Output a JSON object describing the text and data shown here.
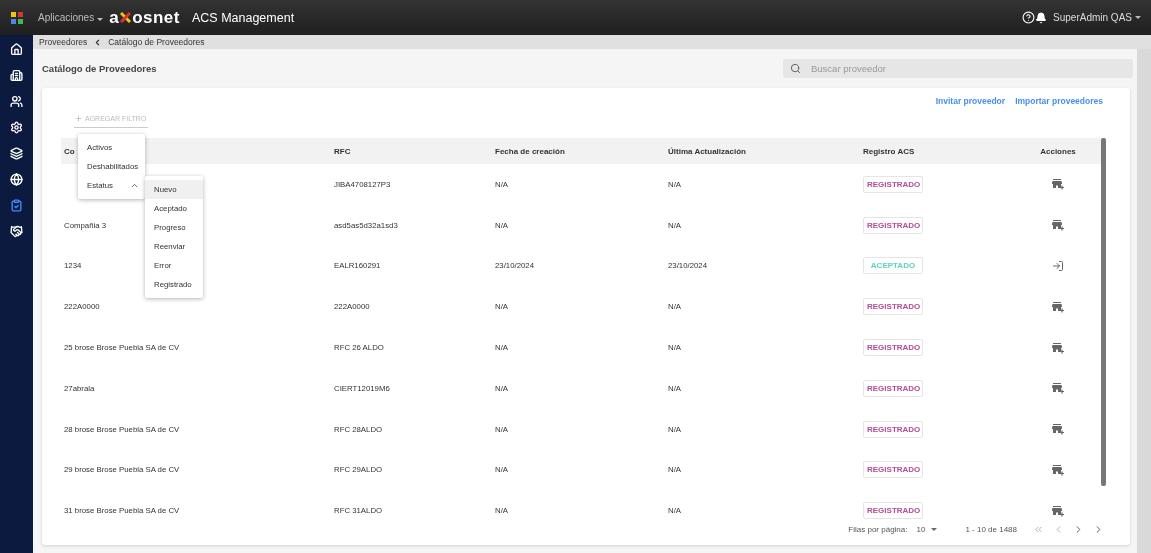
{
  "topbar": {
    "apps_label": "Aplicaciones",
    "logo": {
      "before": "a",
      "after": "osnet"
    },
    "title": "ACS Management",
    "user": "SuperAdmin QAS"
  },
  "sidebar": {
    "items": [
      {
        "selected": false
      },
      {
        "selected": false
      },
      {
        "selected": false
      },
      {
        "selected": false
      },
      {
        "selected": false
      },
      {
        "selected": false
      },
      {
        "selected": true
      },
      {
        "selected": false
      }
    ]
  },
  "breadcrumb": {
    "parent": "Proveedores",
    "current": "Catálogo de Proveedores"
  },
  "page_title": "Catálogo de Proveedores",
  "search": {
    "placeholder": "Buscar proveedor"
  },
  "links": [
    "Invitar proveedor",
    "Importar proveedores"
  ],
  "add_filter": "AGREGAR FILTRO",
  "filter_menu": [
    {
      "label": "Activos"
    },
    {
      "label": "Deshabilitados"
    },
    {
      "label": "Estatus",
      "expanded": true
    }
  ],
  "status_menu": [
    {
      "label": "Nuevo",
      "selected": true
    },
    {
      "label": "Aceptado",
      "selected": false
    },
    {
      "label": "Progreso",
      "selected": false
    },
    {
      "label": "Reenviar",
      "selected": false
    },
    {
      "label": "Error",
      "selected": false
    },
    {
      "label": "Registrado",
      "selected": false
    }
  ],
  "table": {
    "columns": [
      "Co",
      "RFC",
      "Fecha de creación",
      "Última Actualización",
      "Registro ACS",
      "Acciones"
    ],
    "rows": [
      {
        "rfc": "JIBA4708127P3",
        "created": "N/A",
        "updated": "N/A",
        "status": "REGISTRADO",
        "kind": "registered"
      },
      {
        "name": "Compañia 3",
        "rfc": "asd5as5d32a1sd3",
        "created": "N/A",
        "updated": "N/A",
        "status": "REGISTRADO",
        "kind": "registered"
      },
      {
        "name": "1234",
        "rfc": "EALR160291",
        "created": "23/10/2024",
        "updated": "23/10/2024",
        "status": "ACEPTADO",
        "kind": "accepted"
      },
      {
        "name": "222A0000",
        "rfc": "222A0000",
        "created": "N/A",
        "updated": "N/A",
        "status": "REGISTRADO",
        "kind": "registered"
      },
      {
        "name": "25 brose Brose Puebla SA de CV",
        "rfc": "RFC 26 ALDO",
        "created": "N/A",
        "updated": "N/A",
        "status": "REGISTRADO",
        "kind": "registered"
      },
      {
        "name": "27abrala",
        "rfc": "CIERT12019M6",
        "created": "N/A",
        "updated": "N/A",
        "status": "REGISTRADO",
        "kind": "registered"
      },
      {
        "name": "28 brose Brose Puebla SA de CV",
        "rfc": "RFC 28ALDO",
        "created": "N/A",
        "updated": "N/A",
        "status": "REGISTRADO",
        "kind": "registered"
      },
      {
        "name": "29 brose Brose Puebla SA de CV",
        "rfc": "RFC 29ALDO",
        "created": "N/A",
        "updated": "N/A",
        "status": "REGISTRADO",
        "kind": "registered"
      },
      {
        "name": "31 brose Brose Puebla SA de CV",
        "rfc": "RFC 31ALDO",
        "created": "N/A",
        "updated": "N/A",
        "status": "REGISTRADO",
        "kind": "registered"
      }
    ]
  },
  "pagination": {
    "rows_label": "Filas por página:",
    "rows_value": "10",
    "range": "1 - 10 de 1488"
  }
}
